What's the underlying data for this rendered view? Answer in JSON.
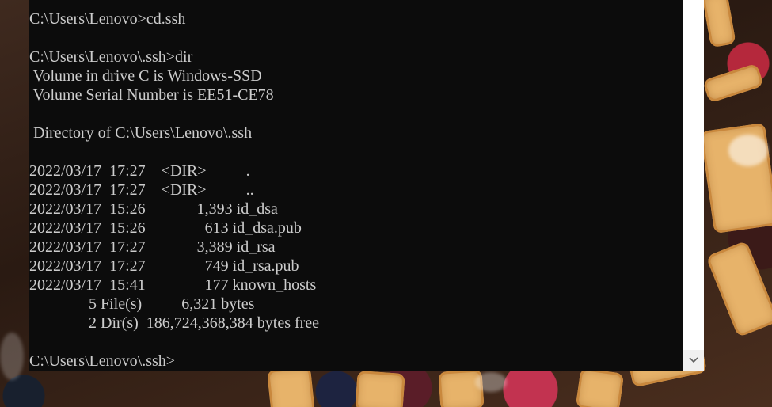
{
  "console": {
    "lines": [
      "C:\\Users\\Lenovo>cd.ssh",
      "",
      "C:\\Users\\Lenovo\\.ssh>dir",
      " Volume in drive C is Windows-SSD",
      " Volume Serial Number is EE51-CE78",
      "",
      " Directory of C:\\Users\\Lenovo\\.ssh",
      "",
      "2022/03/17  17:27    <DIR>          .",
      "2022/03/17  17:27    <DIR>          ..",
      "2022/03/17  15:26             1,393 id_dsa",
      "2022/03/17  15:26               613 id_dsa.pub",
      "2022/03/17  17:27             3,389 id_rsa",
      "2022/03/17  17:27               749 id_rsa.pub",
      "2022/03/17  15:41               177 known_hosts",
      "               5 File(s)          6,321 bytes",
      "               2 Dir(s)  186,724,368,384 bytes free",
      "",
      "C:\\Users\\Lenovo\\.ssh>"
    ]
  },
  "scrollbar": {
    "down_arrow_icon": "chevron-down-icon"
  },
  "colors": {
    "console_background": "#0c0c0c",
    "console_text": "#cccccc",
    "scrollbar_track": "#f0f0f0"
  }
}
